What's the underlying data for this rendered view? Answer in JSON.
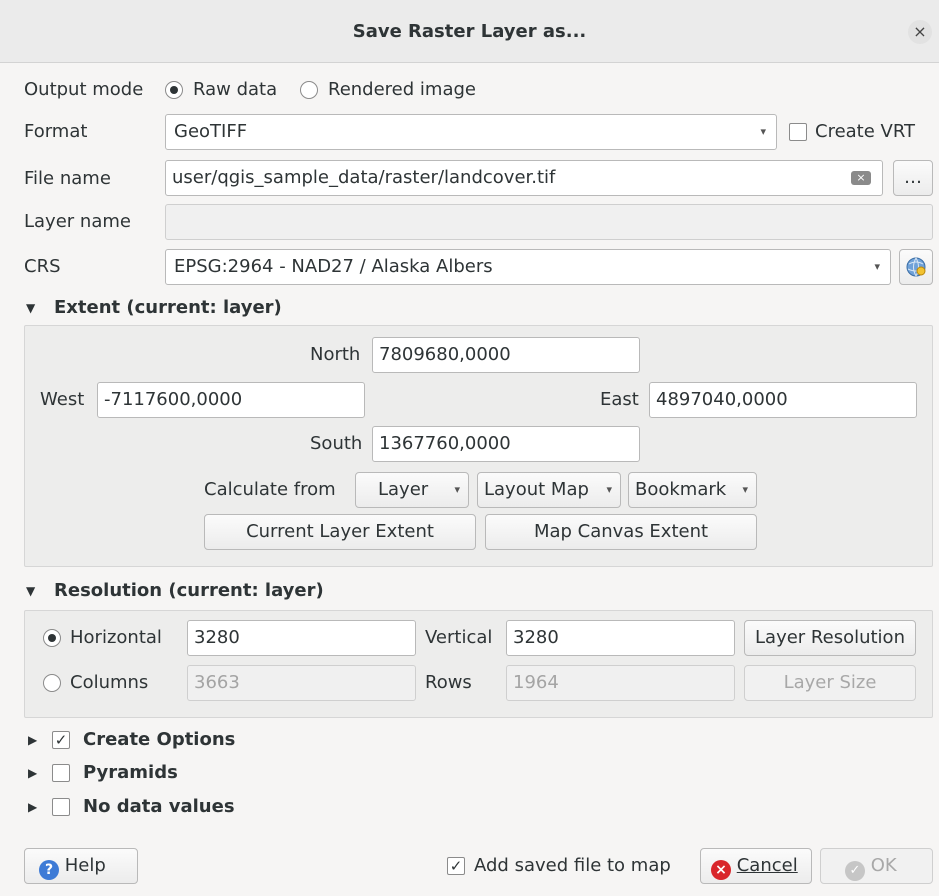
{
  "dialog": {
    "title": "Save Raster Layer as...",
    "close_glyph": "×"
  },
  "output_mode": {
    "label": "Output mode",
    "raw": "Raw data",
    "rendered": "Rendered image",
    "selected": "Raw data"
  },
  "format": {
    "label": "Format",
    "value": "GeoTIFF",
    "create_vrt": "Create VRT",
    "create_vrt_checked": false
  },
  "file_name": {
    "label": "File name",
    "value": "user/qgis_sample_data/raster/landcover.tif",
    "browse": "…"
  },
  "layer_name": {
    "label": "Layer name",
    "value": ""
  },
  "crs": {
    "label": "CRS",
    "value": "EPSG:2964 - NAD27 / Alaska Albers"
  },
  "extent": {
    "header": "Extent (current: layer)",
    "north_label": "North",
    "north": "7809680,0000",
    "west_label": "West",
    "west": "-7117600,0000",
    "east_label": "East",
    "east": "4897040,0000",
    "south_label": "South",
    "south": "1367760,0000",
    "calculate_from": "Calculate from",
    "layer_btn": "Layer",
    "layout_map_btn": "Layout Map",
    "bookmark_btn": "Bookmark",
    "current_layer_extent": "Current Layer Extent",
    "map_canvas_extent": "Map Canvas Extent"
  },
  "resolution": {
    "header": "Resolution (current: layer)",
    "horizontal_label": "Horizontal",
    "horizontal": "3280",
    "vertical_label": "Vertical",
    "vertical": "3280",
    "layer_resolution": "Layer Resolution",
    "columns_label": "Columns",
    "columns": "3663",
    "rows_label": "Rows",
    "rows": "1964",
    "layer_size": "Layer Size",
    "selected": "Horizontal"
  },
  "options": {
    "create_options": "Create Options",
    "create_options_checked": true,
    "pyramids": "Pyramids",
    "pyramids_checked": false,
    "no_data_values": "No data values",
    "no_data_checked": false
  },
  "footer": {
    "help": "Help",
    "add_saved": "Add saved file to map",
    "add_saved_checked": true,
    "cancel": "Cancel",
    "ok": "OK"
  }
}
